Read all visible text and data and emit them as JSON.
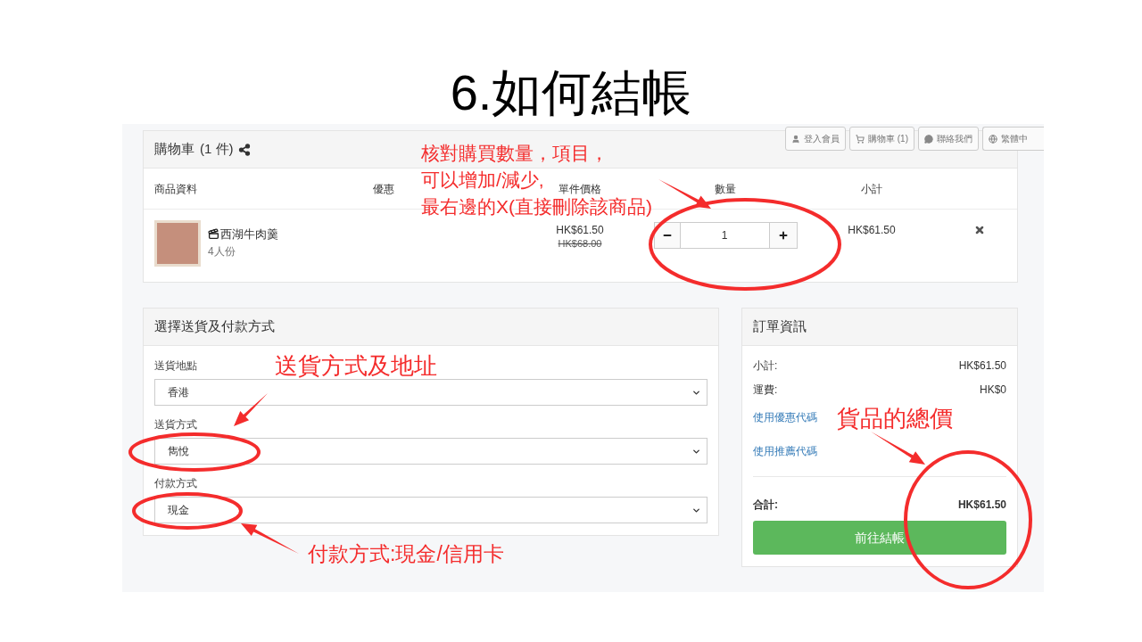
{
  "slide": {
    "title": "6.如何結帳"
  },
  "nav": [
    {
      "label": "登入會員"
    },
    {
      "label": "購物車 (1)"
    },
    {
      "label": "聯絡我們"
    },
    {
      "label": "繁體中"
    }
  ],
  "cart": {
    "title": "購物車",
    "count": "(1 件)",
    "columns": [
      "商品資料",
      "優惠",
      "單件價格",
      "數量",
      "小計"
    ],
    "items": [
      {
        "name": "西湖牛肉羹",
        "variant": "4人份",
        "price": "HK$61.50",
        "original_price": "HK$68.00",
        "quantity": "1",
        "subtotal": "HK$61.50"
      }
    ]
  },
  "delivery": {
    "title": "選擇送貨及付款方式",
    "fields": [
      {
        "label": "送貨地點",
        "value": "香港"
      },
      {
        "label": "送貨方式",
        "value": "雋悅"
      },
      {
        "label": "付款方式",
        "value": "現金"
      }
    ]
  },
  "order_summary": {
    "title": "訂單資訊",
    "rows": [
      {
        "label": "小計:",
        "value": "HK$61.50"
      },
      {
        "label": "運費:",
        "value": "HK$0"
      }
    ],
    "links": [
      "使用優惠代碼",
      "使用推薦代碼"
    ],
    "total": {
      "label": "合計:",
      "value": "HK$61.50"
    },
    "button": "前往結帳"
  },
  "annotations": [
    {
      "lines": [
        "核對購買數量，項目，",
        "可以增加/減少,",
        "最右邊的X(直接刪除該商品)"
      ]
    },
    {
      "lines": [
        "送貨方式及地址"
      ]
    },
    {
      "lines": [
        "付款方式:現金/信用卡"
      ]
    },
    {
      "lines": [
        "貨品的總價"
      ]
    }
  ]
}
